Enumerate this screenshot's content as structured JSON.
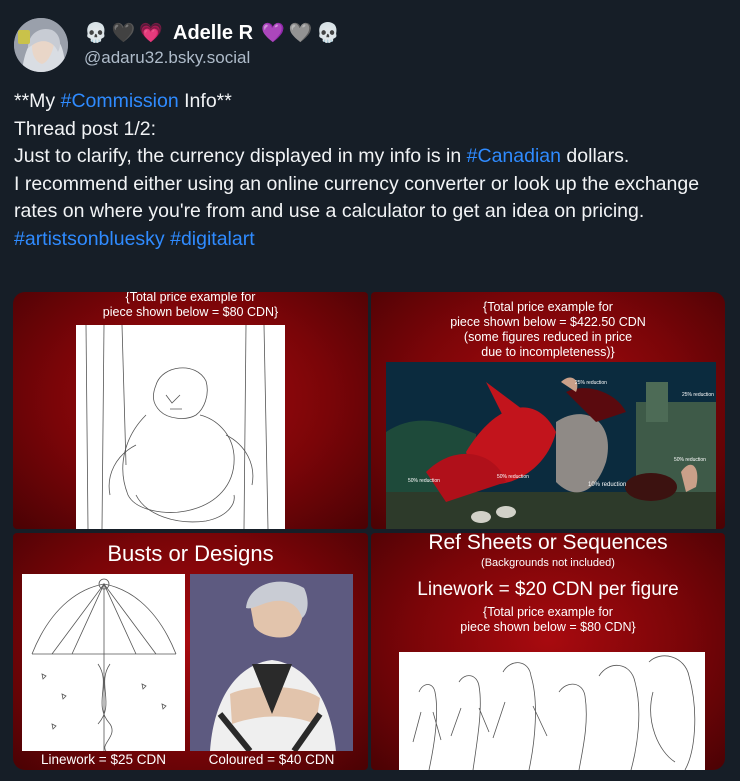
{
  "author": {
    "display_name": "Adelle R",
    "handle": "@adaru32.bsky.social",
    "name_emojis_left": [
      "💀",
      "🖤",
      "💗"
    ],
    "name_emojis_right": [
      "💜",
      "🩶",
      "💀"
    ]
  },
  "post": {
    "line1_prefix": "**My ",
    "line1_tag": "#Commission",
    "line1_suffix": " Info**",
    "line2": "Thread post 1/2:",
    "line3_prefix": "Just to clarify, the currency displayed in my info is in ",
    "line3_tag": "#Canadian",
    "line3_suffix": " dollars.",
    "line4": "I recommend either using an online currency converter or look up the exchange rates on where you're from and use a calculator to get an idea on pricing.",
    "tag_a": "#artistsonbluesky",
    "tag_b": "#digitalart",
    "tag_color": "#2f8bff"
  },
  "images": {
    "img1": {
      "caption_1": "{Total price example for",
      "caption_2": "piece shown below = $80 CDN}"
    },
    "img2": {
      "caption_1": "{Total price example for",
      "caption_2": "piece shown below = $422.50 CDN",
      "caption_3": "(some figures reduced in price",
      "caption_4": "due to incompleteness)}",
      "labels": [
        "25% reduction",
        "25% reduction",
        "50% reduction",
        "50% reduction",
        "50% reduction",
        "10% reduction"
      ]
    },
    "img3": {
      "title": "Busts or Designs",
      "linework": "Linework = $25 CDN",
      "coloured": "Coloured = $40 CDN"
    },
    "img4": {
      "title": "Ref Sheets or Sequences",
      "subtitle": "(Backgrounds not included)",
      "price": "Linework = $20 CDN per figure",
      "caption_1": "{Total price example for",
      "caption_2": "piece shown below = $80 CDN}"
    }
  },
  "colors": {
    "background": "#161e27",
    "tile_red": "#8a060a"
  }
}
